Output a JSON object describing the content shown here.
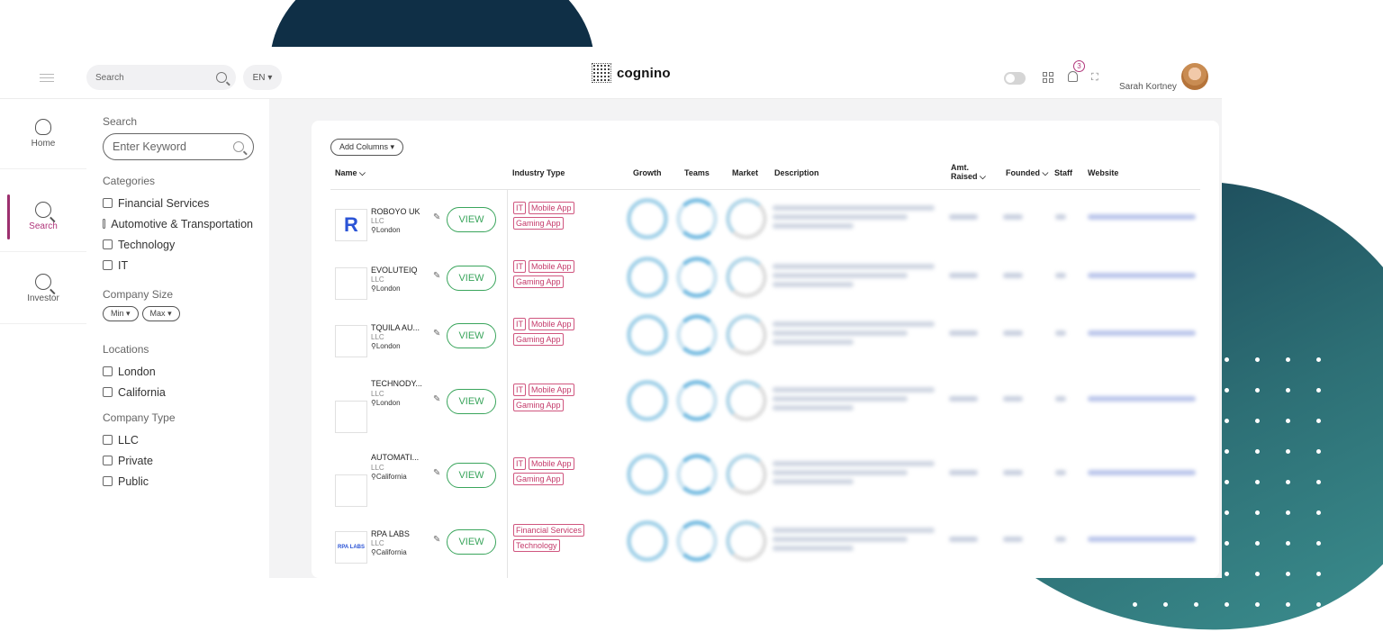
{
  "header": {
    "search_placeholder": "Search",
    "language": "EN",
    "brand": "cognino",
    "notification_count": "3",
    "user_name": "Sarah Kortney"
  },
  "nav": {
    "items": [
      {
        "label": "Home",
        "icon": "hot-air-balloon-icon"
      },
      {
        "label": "Search",
        "icon": "search-icon",
        "active": true
      },
      {
        "label": "Investor",
        "icon": "search-icon"
      }
    ]
  },
  "filters": {
    "search_title": "Search",
    "keyword_placeholder": "Enter Keyword",
    "categories_title": "Categories",
    "categories": [
      "Financial Services",
      "Automotive & Transportation",
      "Technology",
      "IT"
    ],
    "company_size_title": "Company Size",
    "size_min": "Min",
    "size_max": "Max",
    "locations_title": "Locations",
    "locations": [
      "London",
      "California"
    ],
    "company_type_title": "Company Type",
    "company_types": [
      "LLC",
      "Private",
      "Public"
    ]
  },
  "table": {
    "add_columns": "Add Columns",
    "columns": {
      "name": "Name",
      "industry": "Industry Type",
      "growth": "Growth",
      "teams": "Teams",
      "market": "Market",
      "description": "Description",
      "amt_raised_1": "Amt.",
      "amt_raised_2": "Raised",
      "founded": "Founded",
      "staff": "Staff",
      "website": "Website"
    },
    "view_label": "VIEW",
    "rows": [
      {
        "name": "ROBOYO UK",
        "type": "LLC",
        "location": "London",
        "logo": "R",
        "tags": [
          "IT",
          "Mobile App",
          "Gaming App"
        ]
      },
      {
        "name": "EVOLUTEIQ",
        "type": "LLC",
        "location": "London",
        "logo": "",
        "tags": [
          "IT",
          "Mobile App",
          "Gaming App"
        ]
      },
      {
        "name": "TQUILA AU...",
        "type": "LLC",
        "location": "London",
        "logo": "",
        "tags": [
          "IT",
          "Mobile App",
          "Gaming App"
        ]
      },
      {
        "name": "TECHNODY...",
        "type": "LLC",
        "location": "London",
        "logo": "",
        "tags": [
          "IT",
          "Mobile App",
          "Gaming App"
        ]
      },
      {
        "name": "AUTOMATI...",
        "type": "LLC",
        "location": "California",
        "logo": "",
        "tags": [
          "IT",
          "Mobile App",
          "Gaming App"
        ]
      },
      {
        "name": "RPA LABS",
        "type": "LLC",
        "location": "California",
        "logo": "RPA LABS",
        "tags": [
          "Financial Services",
          "Technology"
        ]
      }
    ]
  },
  "colors": {
    "accent": "#9c2f6e",
    "view_button": "#3aa55c",
    "tag": "#c43a6a",
    "blob_dark": "#0f2f46",
    "blob_teal": "#2d6f75"
  }
}
